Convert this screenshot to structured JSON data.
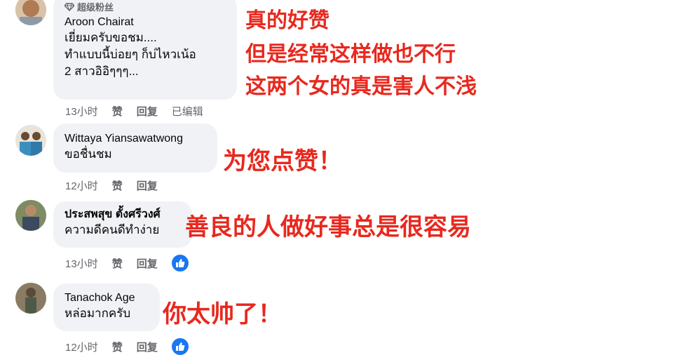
{
  "overlay_colors": {
    "text": "#e8281e"
  },
  "comments": [
    {
      "badge": "超级粉丝",
      "author": "Aroon Chairat",
      "text": "เยี่ยมครับขอชม....\nทำแบบนี้บ่อยๆ ก็บ่ไหวเน้อ\n2 สาวอิอิๆๆๆ...",
      "time": "13小时",
      "like": "赞",
      "reply": "回复",
      "edited": "已编辑",
      "overlay": [
        "真的好赞",
        "但是经常这样做也不行",
        "这两个女的真是害人不浅"
      ]
    },
    {
      "author": "Wittaya Yiansawatwong",
      "text": "ขอชื่นชม",
      "time": "12小时",
      "like": "赞",
      "reply": "回复",
      "overlay": [
        "为您点赞！"
      ]
    },
    {
      "author": "ประสพสุข ตั้งศรีวงศ์",
      "text": "ความดีคนดีทำง่าย",
      "time": "13小时",
      "like": "赞",
      "reply": "回复",
      "overlay": [
        "善良的人做好事总是很容易"
      ]
    },
    {
      "author": "Tanachok Age",
      "text": "หล่อมากครับ",
      "time": "12小时",
      "like": "赞",
      "reply": "回复",
      "overlay": [
        "你太帅了！"
      ]
    }
  ]
}
